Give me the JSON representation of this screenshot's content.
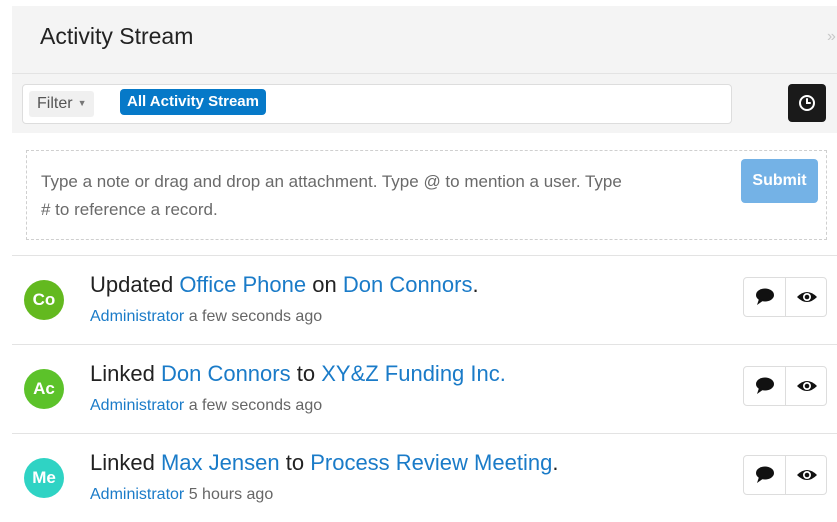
{
  "header": {
    "title": "Activity Stream",
    "collapse_icon": "double-chevron-right-icon"
  },
  "filter": {
    "dropdown_label": "Filter",
    "active_filter": "All Activity Stream",
    "clock_icon": "clock-icon"
  },
  "note": {
    "placeholder_line1": "Type a note or drag and drop an attachment. Type @ to mention a user. Type",
    "placeholder_line2": "# to reference a record.",
    "submit_label": "Submit"
  },
  "colors": {
    "accent": "#0679c8",
    "link": "#1a7bc8",
    "submit_disabled": "#74b2e6"
  },
  "activities": [
    {
      "avatar_initials": "Co",
      "avatar_color": "#63b91f",
      "verb": "Updated",
      "target": "Office Phone",
      "connector": "on",
      "record": "Don Connors",
      "end": ".",
      "author": "Administrator",
      "time": "a few seconds ago"
    },
    {
      "avatar_initials": "Ac",
      "avatar_color": "#5cc22a",
      "verb": "Linked",
      "target": "Don Connors",
      "connector": "to",
      "record": "XY&Z Funding Inc.",
      "end": "",
      "author": "Administrator",
      "time": "a few seconds ago"
    },
    {
      "avatar_initials": "Me",
      "avatar_color": "#2fd3c4",
      "verb": "Linked",
      "target": "Max Jensen",
      "connector": "to",
      "record": "Process Review Meeting",
      "end": ".",
      "author": "Administrator",
      "time": "5 hours ago"
    }
  ]
}
